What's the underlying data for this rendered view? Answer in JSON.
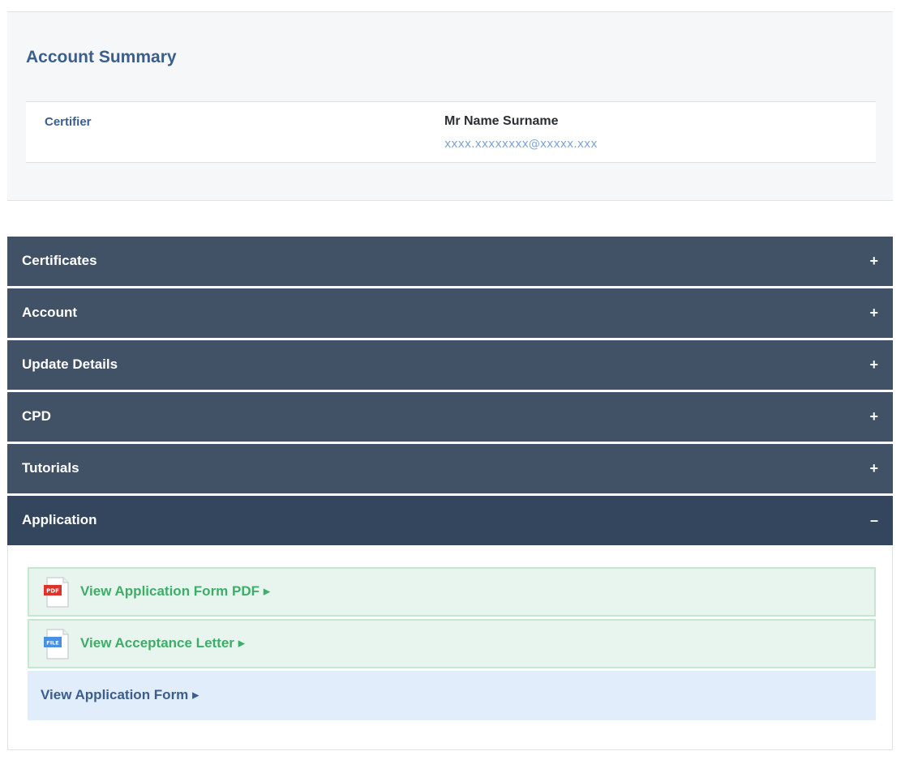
{
  "summary": {
    "title": "Account Summary",
    "label": "Certifier",
    "name": "Mr Name Surname",
    "email": "xxxx.xxxxxxxx@xxxxx.xxx"
  },
  "accordion": {
    "sections": [
      {
        "label": "Certificates",
        "toggle": "+"
      },
      {
        "label": "Account",
        "toggle": "+"
      },
      {
        "label": "Update Details",
        "toggle": "+"
      },
      {
        "label": "CPD",
        "toggle": "+"
      },
      {
        "label": "Tutorials",
        "toggle": "+"
      },
      {
        "label": "Application",
        "toggle": "–"
      }
    ],
    "application_links": [
      {
        "label": "View Application Form PDF ▸",
        "icon": "pdf-file-icon",
        "icon_text": "PDF"
      },
      {
        "label": "View Acceptance Letter ▸",
        "icon": "generic-file-icon",
        "icon_text": "FILE"
      },
      {
        "label": "View Application Form ▸"
      }
    ]
  },
  "colors": {
    "header_bg": "#415267",
    "header_open_bg": "#33465e",
    "accent_blue": "#3b5e8c",
    "link_green": "#3cae66",
    "pdf_red": "#d9352a",
    "file_blue": "#4a90e2"
  }
}
